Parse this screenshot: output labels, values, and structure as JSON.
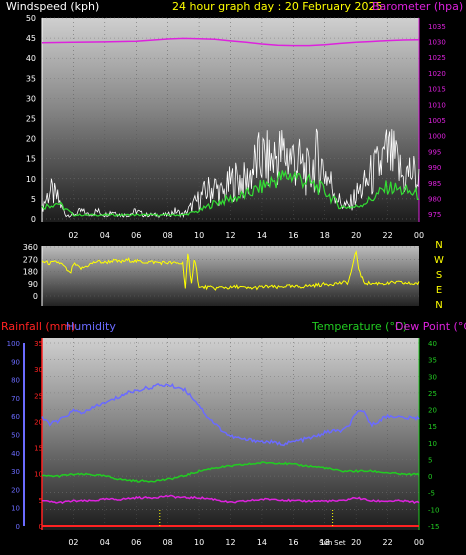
{
  "header": {
    "windspeed_label": "Windspeed (kph)",
    "graph_title": "24 hour graph day : 20 February 2025",
    "barometer_label": "Barometer (hpa)"
  },
  "lower_header": {
    "rainfall_label": "Rainfall (mm)",
    "humidity_label": "Humidity",
    "temperature_label": "Temperature (°C)",
    "dewpoint_label": "Dew Point (°C)"
  },
  "colors": {
    "windspeed": "#ffffff",
    "wind_avg": "#33dd33",
    "barometer": "#dd22dd",
    "direction": "#ffff00",
    "humidity": "#6b6bff",
    "temperature": "#22cc22",
    "dewpoint": "#dd22dd",
    "rainfall": "#ff2222",
    "sunrise_sunset": "#ffff00"
  },
  "chart_data": [
    {
      "type": "line",
      "title": "24 hour graph day : 20 February 2025",
      "x_ticks": [
        "02",
        "04",
        "06",
        "08",
        "10",
        "12",
        "14",
        "16",
        "18",
        "20",
        "22",
        "00"
      ],
      "xlim": [
        0,
        24
      ],
      "left_axis": {
        "label": "Windspeed (kph)",
        "ticks": [
          0,
          5,
          10,
          15,
          20,
          25,
          30,
          35,
          40,
          45,
          50
        ],
        "ylim": [
          0,
          50
        ]
      },
      "right_axis": {
        "label": "Barometer (hpa)",
        "ticks": [
          975,
          980,
          985,
          990,
          995,
          1000,
          1005,
          1010,
          1015,
          1020,
          1025,
          1030,
          1035
        ],
        "ylim": [
          972.5,
          1037.5
        ]
      },
      "series": [
        {
          "name": "Windspeed (kph)",
          "axis": "left",
          "x": [
            0,
            0.5,
            1,
            1.5,
            2,
            2.5,
            3,
            3.5,
            4,
            4.5,
            5,
            5.5,
            6,
            6.5,
            7,
            7.5,
            8,
            8.5,
            9,
            9.5,
            10,
            10.5,
            11,
            11.5,
            12,
            12.5,
            13,
            13.5,
            14,
            14.5,
            15,
            15.5,
            16,
            16.5,
            17,
            17.5,
            18,
            18.5,
            19,
            19.5,
            20,
            20.5,
            21,
            21.5,
            22,
            22.5,
            23,
            23.5,
            24
          ],
          "values": [
            3,
            7,
            5,
            1,
            1,
            2,
            1,
            2,
            1,
            2,
            1,
            1,
            2,
            1,
            1,
            1,
            1,
            2,
            1,
            3,
            5,
            7,
            8,
            6,
            9,
            10,
            9,
            13,
            15,
            14,
            16,
            16,
            15,
            13,
            11,
            15,
            12,
            8,
            4,
            3,
            6,
            8,
            11,
            13,
            16,
            14,
            10,
            12,
            9
          ]
        },
        {
          "name": "Average windspeed",
          "axis": "left",
          "x": [
            0,
            1,
            2,
            3,
            4,
            5,
            6,
            7,
            8,
            9,
            10,
            11,
            12,
            13,
            14,
            15,
            16,
            17,
            18,
            19,
            20,
            21,
            22,
            23,
            24
          ],
          "values": [
            3,
            4,
            1,
            1,
            1,
            1,
            1,
            1,
            1,
            1,
            2,
            4,
            5,
            6,
            8,
            10,
            11,
            9,
            7,
            3,
            3,
            5,
            8,
            7,
            6
          ]
        },
        {
          "name": "Barometer (hpa)",
          "axis": "right",
          "x": [
            0,
            2,
            4,
            6,
            8,
            9,
            10,
            11,
            12,
            13,
            14,
            15,
            16,
            17,
            18,
            19,
            20,
            21,
            22,
            23,
            24
          ],
          "values": [
            1029.6,
            1029.8,
            1029.9,
            1030.1,
            1030.8,
            1031.0,
            1030.9,
            1030.7,
            1030.2,
            1029.8,
            1029.2,
            1028.8,
            1028.7,
            1028.7,
            1029.0,
            1029.4,
            1029.8,
            1030.0,
            1030.3,
            1030.5,
            1030.6
          ]
        }
      ]
    },
    {
      "type": "scatter",
      "title": "",
      "x_ticks": [
        "02",
        "04",
        "06",
        "08",
        "10",
        "12",
        "14",
        "16",
        "18",
        "20",
        "22",
        "00"
      ],
      "xlim": [
        0,
        24
      ],
      "left_axis": {
        "ticks": [
          0,
          90,
          180,
          270,
          360
        ],
        "ylim": [
          0,
          360
        ]
      },
      "compass_labels": [
        "N",
        "W",
        "S",
        "E",
        "N"
      ],
      "series": [
        {
          "name": "Wind direction",
          "x": [
            0,
            0.5,
            1,
            1.3,
            1.8,
            2,
            2.5,
            3,
            3.5,
            4,
            4.5,
            5,
            5.5,
            6,
            6.5,
            7,
            7.5,
            8,
            8.5,
            9,
            9.1,
            9.3,
            9.5,
            9.7,
            10,
            10.5,
            11,
            11.5,
            12,
            12.5,
            13,
            13.5,
            14,
            14.5,
            15,
            15.5,
            16,
            16.5,
            17,
            17.5,
            18,
            18.5,
            19,
            19.5,
            19.8,
            20,
            20.2,
            20.5,
            21,
            21.5,
            22,
            22.5,
            23,
            23.5,
            24
          ],
          "values": [
            255,
            240,
            250,
            230,
            160,
            235,
            200,
            230,
            255,
            245,
            260,
            250,
            265,
            255,
            250,
            250,
            245,
            245,
            240,
            240,
            30,
            330,
            60,
            300,
            60,
            65,
            55,
            65,
            60,
            70,
            55,
            60,
            65,
            70,
            60,
            75,
            65,
            70,
            75,
            80,
            85,
            90,
            95,
            100,
            230,
            330,
            180,
            100,
            90,
            95,
            90,
            100,
            95,
            90,
            95
          ]
        }
      ]
    },
    {
      "type": "line",
      "title": "",
      "x_ticks": [
        "02",
        "04",
        "06",
        "08",
        "10",
        "12",
        "14",
        "16",
        "18",
        "20",
        "22",
        "00"
      ],
      "x_markers": [
        "Sunrise",
        "Sunset"
      ],
      "xlim": [
        0,
        24
      ],
      "left_axis": {
        "label": "Humidity",
        "ticks": [
          0,
          10,
          20,
          30,
          40,
          50,
          60,
          70,
          80,
          90,
          100
        ],
        "ylim": [
          0,
          100
        ]
      },
      "rain_axis": {
        "label": "Rainfall (mm)",
        "ticks": [
          0,
          5,
          10,
          15,
          20,
          25,
          30,
          35
        ],
        "ylim": [
          0,
          35
        ]
      },
      "right_axis": {
        "label": "Temperature (°C)",
        "ticks": [
          -15,
          -10,
          -5,
          0,
          5,
          10,
          15,
          20,
          25,
          30,
          35,
          40
        ],
        "ylim": [
          -15,
          40
        ]
      },
      "series": [
        {
          "name": "Humidity",
          "axis": "left",
          "x": [
            0,
            0.5,
            1,
            1.5,
            2,
            2.5,
            3,
            3.5,
            4,
            4.5,
            5,
            5.5,
            6,
            6.5,
            7,
            7.5,
            8,
            8.5,
            9,
            9.5,
            10,
            10.5,
            11,
            11.5,
            12,
            12.5,
            13,
            13.5,
            14,
            14.5,
            15,
            15.5,
            16,
            16.5,
            17,
            17.5,
            18,
            18.5,
            19,
            19.5,
            20,
            20.5,
            21,
            21.5,
            22,
            22.5,
            23,
            23.5,
            24
          ],
          "values": [
            59,
            56,
            57,
            60,
            63,
            62,
            63,
            66,
            67,
            69,
            71,
            73,
            74,
            75,
            76,
            77,
            77,
            76,
            75,
            71,
            66,
            60,
            56,
            52,
            49,
            48,
            47,
            47,
            46,
            46,
            45,
            45,
            46,
            47,
            48,
            49,
            51,
            52,
            52,
            54,
            62,
            62,
            55,
            58,
            60,
            60,
            59,
            59,
            59
          ]
        },
        {
          "name": "Temperature (°C)",
          "axis": "right",
          "x": [
            0,
            1,
            2,
            3,
            4,
            5,
            6,
            7,
            8,
            9,
            10,
            11,
            12,
            13,
            14,
            15,
            16,
            17,
            18,
            19,
            20,
            21,
            22,
            23,
            24
          ],
          "values": [
            0,
            0,
            0.5,
            0.5,
            0,
            -1,
            -1.5,
            -1.5,
            -1,
            0,
            1.5,
            2.5,
            3,
            3.5,
            4,
            4,
            3.5,
            3,
            2.5,
            1.5,
            1.5,
            1.5,
            1,
            0.5,
            0.5
          ]
        },
        {
          "name": "Dew Point (°C)",
          "axis": "right",
          "x": [
            0,
            1,
            2,
            3,
            4,
            5,
            6,
            7,
            8,
            9,
            10,
            11,
            12,
            13,
            14,
            15,
            16,
            17,
            18,
            19,
            20,
            21,
            22,
            23,
            24
          ],
          "values": [
            -7.5,
            -8,
            -7.5,
            -7.5,
            -7,
            -7,
            -6.5,
            -6.5,
            -6,
            -6.5,
            -6.5,
            -7,
            -8,
            -7.5,
            -7,
            -7,
            -7.5,
            -7.5,
            -7.5,
            -7.5,
            -6.5,
            -7.5,
            -7.5,
            -7.5,
            -8
          ]
        },
        {
          "name": "Rainfall (mm)",
          "axis": "rain",
          "x": [
            0,
            24
          ],
          "values": [
            0,
            0
          ]
        }
      ]
    }
  ]
}
